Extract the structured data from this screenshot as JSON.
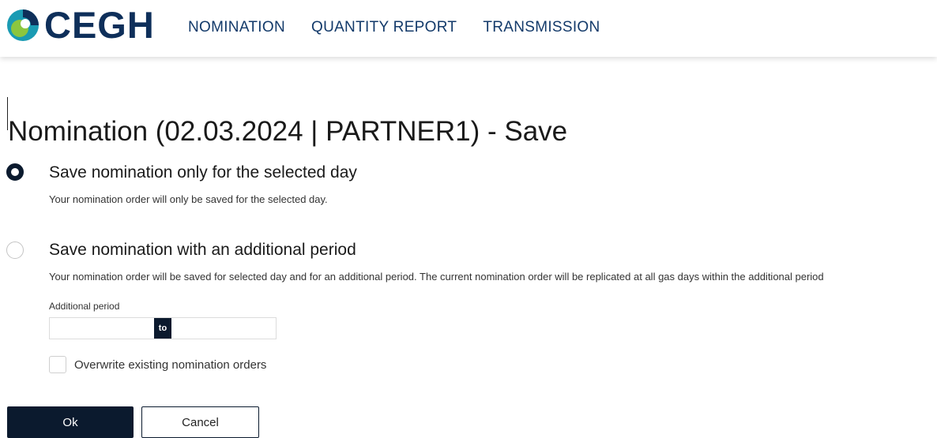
{
  "brand": {
    "name": "CEGH",
    "colors": {
      "navy": "#0e2f5a",
      "teal": "#1a9bb3",
      "green": "#8cc63f",
      "dark": "#0b1a2e"
    }
  },
  "nav": {
    "items": [
      {
        "label": "NOMINATION"
      },
      {
        "label": "QUANTITY REPORT"
      },
      {
        "label": "TRANSMISSION"
      }
    ]
  },
  "page": {
    "title": "Nomination (02.03.2024 | PARTNER1) - Save"
  },
  "options": [
    {
      "label": "Save nomination only for the selected day",
      "description": "Your nomination order will only be saved for the selected day.",
      "selected": true
    },
    {
      "label": "Save nomination with an additional period",
      "description": "Your nomination order will be saved for selected day and for an additional period. The current nomination order will be replicated at all gas days within the additional period",
      "selected": false
    }
  ],
  "period": {
    "label": "Additional period",
    "from_value": "",
    "to_label": "to",
    "until_value": ""
  },
  "overwrite": {
    "label": "Overwrite existing nomination orders",
    "checked": false
  },
  "actions": {
    "ok_label": "Ok",
    "cancel_label": "Cancel"
  }
}
